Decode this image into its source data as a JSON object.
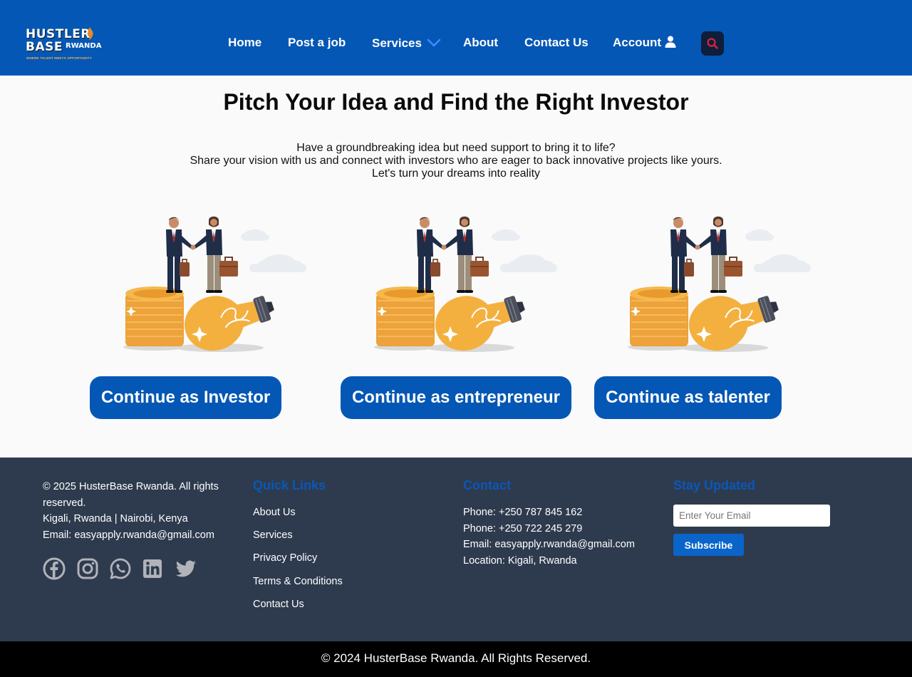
{
  "header": {
    "logo": {
      "line1": "HUSTLER",
      "line2": "BASE",
      "line2b": "RWANDA",
      "tagline": "WHERE TALENT MEETS OPPORTUNITY"
    },
    "nav": [
      {
        "label": "Home"
      },
      {
        "label": "Post a job"
      },
      {
        "label": "Services"
      },
      {
        "label": "About"
      },
      {
        "label": "Contact Us"
      },
      {
        "label": "Account"
      }
    ],
    "colors": {
      "bar": "#0457b5",
      "search_bg": "#0f1e3a",
      "search_icon": "#d9243a",
      "chevron": "#3b8cff"
    }
  },
  "main": {
    "title": "Pitch Your Idea and Find the Right Investor",
    "subtitle_lines": [
      "Have a groundbreaking idea but need support to bring it to life?",
      "Share your vision with us and connect with investors who are eager to back innovative projects like yours.",
      "Let's turn your dreams into reality"
    ],
    "cards": [
      {
        "illustration": "handshake-coins-lightbulb",
        "button": "Continue as Investor"
      },
      {
        "illustration": "handshake-coins-lightbulb",
        "button": "Continue as entrepreneur"
      },
      {
        "illustration": "handshake-coins-lightbulb",
        "button": "Continue as talenter"
      }
    ]
  },
  "footer": {
    "about": {
      "copyright": "© 2025 HusterBase Rwanda. All rights reserved.",
      "locations": "Kigali, Rwanda | Nairobi, Kenya",
      "email": "Email: easyapply.rwanda@gmail.com",
      "social_icons": [
        "facebook-icon",
        "instagram-icon",
        "whatsapp-icon",
        "linkedin-icon",
        "twitter-icon"
      ]
    },
    "quick_links": {
      "heading": "Quick Links",
      "items": [
        "About Us",
        "Services",
        "Privacy Policy",
        "Terms & Conditions",
        "Contact Us"
      ]
    },
    "contact": {
      "heading": "Contact",
      "lines": [
        "Phone: +250 787 845 162",
        "Phone: +250 722 245 279",
        "Email: easyapply.rwanda@gmail.com",
        "Location: Kigali, Rwanda"
      ]
    },
    "newsletter": {
      "heading": "Stay Updated",
      "placeholder": "Enter Your Email",
      "button": "Subscribe"
    }
  },
  "bottom_bar": {
    "text": "© 2024 HusterBase Rwanda. All Rights Reserved."
  }
}
